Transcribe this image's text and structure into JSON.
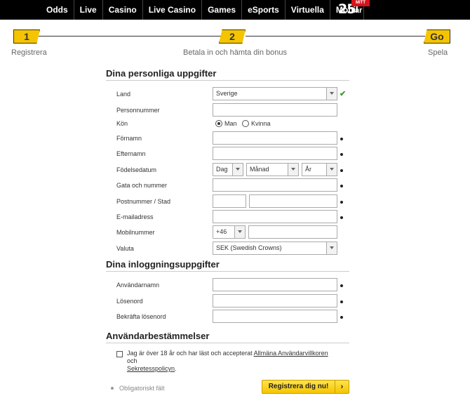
{
  "nav": {
    "items": [
      "Odds",
      "Live",
      "Casino",
      "Live Casino",
      "Games",
      "eSports",
      "Virtuella",
      "Mobil"
    ],
    "badge_num": "25",
    "badge_tag": "MITT",
    "badge_ar": "år"
  },
  "steps": [
    {
      "mark": "1",
      "label": "Registrera"
    },
    {
      "mark": "2",
      "label": "Betala in och hämta din bonus"
    },
    {
      "mark": "Go",
      "label": "Spela"
    }
  ],
  "personal": {
    "title": "Dina personliga uppgifter",
    "land_label": "Land",
    "land_value": "Sverige",
    "personnummer_label": "Personnummer",
    "kon_label": "Kön",
    "kon_man": "Man",
    "kon_kvinna": "Kvinna",
    "fornamn_label": "Förnamn",
    "efternamn_label": "Efternamn",
    "fodelsedatum_label": "Födelsedatum",
    "dag": "Dag",
    "manad": "Månad",
    "ar": "År",
    "gata_label": "Gata och nummer",
    "postnummer_label": "Postnummer / Stad",
    "email_label": "E-mailadress",
    "mobil_label": "Mobilnummer",
    "mobil_prefix": "+46",
    "valuta_label": "Valuta",
    "valuta_value": "SEK (Swedish Crowns)"
  },
  "login": {
    "title": "Dina inloggningsuppgifter",
    "username_label": "Användarnamn",
    "password_label": "Lösenord",
    "confirm_label": "Bekräfta lösenord"
  },
  "terms": {
    "title": "Användarbestämmelser",
    "text_before": "Jag är över 18 år och har läst och accepterat ",
    "link1": "Allmäna Användarvillkoren",
    "text_mid": " och ",
    "link2": "Sekretesspolicyn",
    "text_after": "."
  },
  "footer": {
    "required_note": "Obligatoriskt fält",
    "submit_label": "Registrera dig nu!",
    "submit_arrow": "›"
  }
}
